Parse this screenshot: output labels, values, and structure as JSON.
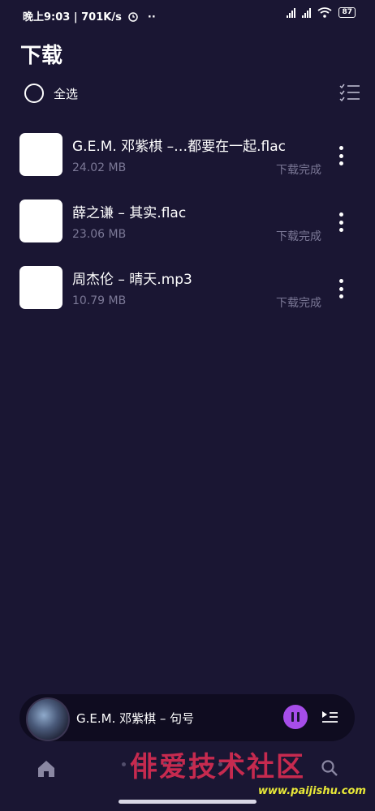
{
  "status_bar": {
    "left_text": "晚上9:03 | 701K/s",
    "battery": "87"
  },
  "header": {
    "title": "下载",
    "select_all_label": "全选"
  },
  "downloads": [
    {
      "title": "G.E.M. 邓紫棋 –…都要在一起.flac",
      "size": "24.02 MB",
      "status": "下载完成"
    },
    {
      "title": "薛之谦 – 其实.flac",
      "size": "23.06 MB",
      "status": "下载完成"
    },
    {
      "title": "周杰伦 – 晴天.mp3",
      "size": "10.79 MB",
      "status": "下载完成"
    }
  ],
  "mini_player": {
    "now_playing": "G.E.M. 邓紫棋 – 句号",
    "accent_color": "#a64de9"
  },
  "watermark": {
    "text": "俳爱技术社区",
    "url": "www.paijishu.com"
  },
  "icons": [
    "alarm-icon",
    "signal-icon",
    "wifi-icon",
    "battery-icon",
    "multi-select-icon",
    "more-vert-icon",
    "pause-icon",
    "queue-icon",
    "home-icon",
    "search-icon"
  ]
}
